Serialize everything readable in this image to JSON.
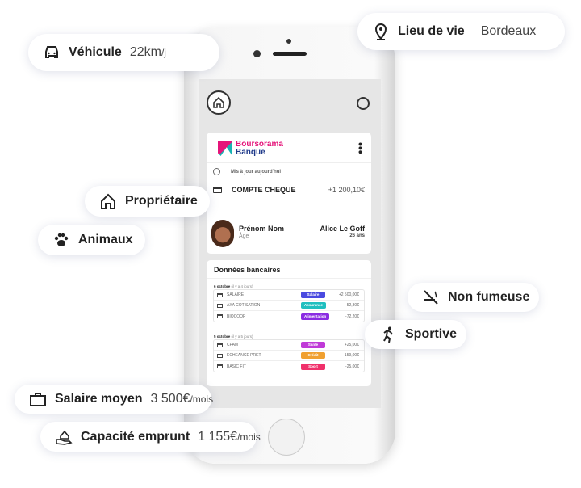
{
  "pills": {
    "vehicule": {
      "label": "Véhicule",
      "value": "22km",
      "unit": "/j",
      "icon": "car-icon"
    },
    "lieu": {
      "label": "Lieu de vie",
      "value": "Bordeaux",
      "icon": "map-pin-icon"
    },
    "proprietaire": {
      "label": "Propriétaire",
      "icon": "house-icon"
    },
    "animaux": {
      "label": "Animaux",
      "icon": "paw-icon"
    },
    "non_fumeuse": {
      "label": "Non fumeuse",
      "icon": "no-smoking-icon"
    },
    "sportive": {
      "label": "Sportive",
      "icon": "running-icon"
    },
    "salaire": {
      "label": "Salaire moyen",
      "value": "3 500€",
      "unit": "/mois",
      "icon": "briefcase-icon"
    },
    "capacite": {
      "label": "Capacité emprunt",
      "value": "1 155€",
      "unit": "/mois",
      "icon": "hand-money-icon"
    }
  },
  "bank": {
    "logo_line1": "Boursorama",
    "logo_line2": "Banque",
    "updated": "Mis à jour aujourd'hui",
    "account": "COMPTE CHEQUE",
    "balance": "+1 200,10€"
  },
  "profile": {
    "label": "Prénom Nom",
    "sublabel": "Âge",
    "name": "Alice Le Goff",
    "age": "26 ans"
  },
  "donnees": {
    "title": "Données bancaires",
    "groups": [
      {
        "date": "6 octobre",
        "ago": "(il y a 4 jours)",
        "rows": [
          {
            "label": "SALAIRE",
            "tag": "Salaire",
            "color": "#4a4ae0",
            "amount": "+2 500,00€"
          },
          {
            "label": "AXA COTISATION",
            "tag": "Assurance",
            "color": "#1fbfbf",
            "amount": "-52,30€"
          },
          {
            "label": "BIOCOOP",
            "tag": "Alimentation",
            "color": "#8a2be2",
            "amount": "-72,20€"
          }
        ]
      },
      {
        "date": "5 octobre",
        "ago": "(il y a 5 jours)",
        "rows": [
          {
            "label": "CPAM",
            "tag": "Santé",
            "color": "#c03ad8",
            "amount": "+25,00€"
          },
          {
            "label": "ECHEANCE PRET",
            "tag": "Crédit",
            "color": "#f0a030",
            "amount": "-159,00€"
          },
          {
            "label": "BASIC FIT",
            "tag": "Sport",
            "color": "#f0306a",
            "amount": "-25,00€"
          }
        ]
      }
    ]
  }
}
